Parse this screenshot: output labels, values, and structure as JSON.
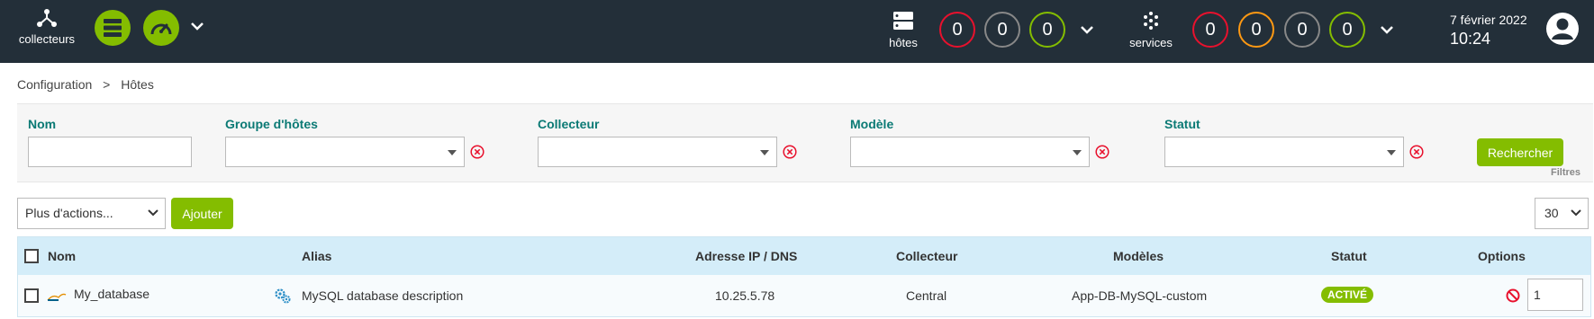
{
  "topbar": {
    "collectors_label": "collecteurs",
    "hosts_label": "hôtes",
    "services_label": "services",
    "host_counts": [
      {
        "value": "0",
        "color": "#e8112d"
      },
      {
        "value": "0",
        "color": "#888888"
      },
      {
        "value": "0",
        "color": "#84bd00"
      }
    ],
    "service_counts": [
      {
        "value": "0",
        "color": "#e8112d"
      },
      {
        "value": "0",
        "color": "#ff9913"
      },
      {
        "value": "0",
        "color": "#888888"
      },
      {
        "value": "0",
        "color": "#84bd00"
      }
    ],
    "date": "7 février 2022",
    "time": "10:24"
  },
  "breadcrumb": {
    "items": [
      "Configuration",
      ">",
      "Hôtes"
    ]
  },
  "filters": {
    "name_label": "Nom",
    "hostgroup_label": "Groupe d'hôtes",
    "collector_label": "Collecteur",
    "template_label": "Modèle",
    "status_label": "Statut",
    "search_button": "Rechercher",
    "panel_tag": "Filtres"
  },
  "actions": {
    "more_actions": "Plus d'actions...",
    "add_button": "Ajouter",
    "page_size": "30"
  },
  "table": {
    "headers": [
      "Nom",
      "Alias",
      "Adresse IP / DNS",
      "Collecteur",
      "Modèles",
      "Statut",
      "Options"
    ],
    "rows": [
      {
        "name": "My_database",
        "alias": "MySQL database description",
        "address": "10.25.5.78",
        "collector": "Central",
        "templates": "App-DB-MySQL-custom",
        "status": "ACTIVÉ",
        "option_value": "1"
      }
    ]
  },
  "colors": {
    "topbar_bg": "#232f39",
    "accent_green": "#84bd00",
    "label_teal": "#0b7a75",
    "table_header_bg": "#d4edf9"
  }
}
